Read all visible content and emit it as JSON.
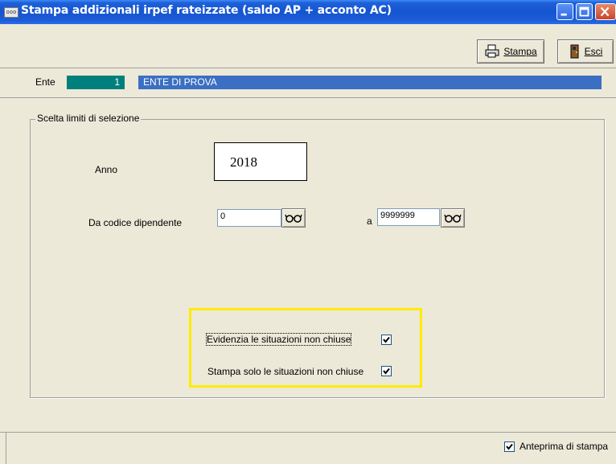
{
  "window": {
    "title": "Stampa addizionali irpef rateizzate (saldo AP + acconto AC)",
    "app_icon_text": "ooo"
  },
  "toolbar": {
    "stampa_label": "Stampa",
    "stampa_icon": "printer-icon",
    "esci_label": "Esci",
    "esci_icon": "exit-door-icon"
  },
  "ente": {
    "label": "Ente",
    "code": "1",
    "name": "ENTE DI PROVA"
  },
  "selection": {
    "group_title": "Scelta limiti di selezione",
    "anno_label": "Anno",
    "anno_value": "2018",
    "da_codice_label": "Da codice dipendente",
    "da_codice_value": "0",
    "a_label": "a",
    "a_value": "9999999",
    "lookup_icon": "glasses-icon"
  },
  "options": {
    "evidenzia_label": "Evidenzia le situazioni non chiuse",
    "evidenzia_checked": true,
    "stampa_solo_label": "Stampa solo le situazioni non chiuse",
    "stampa_solo_checked": true,
    "highlight_color": "#ffeb00"
  },
  "footer": {
    "anteprima_label": "Anteprima di stampa",
    "anteprima_checked": true
  },
  "colors": {
    "titlebar": "#1455d0",
    "ente_code_bg": "#00807c",
    "ente_name_bg": "#3a6fc3",
    "window_bg": "#ece9d8"
  }
}
